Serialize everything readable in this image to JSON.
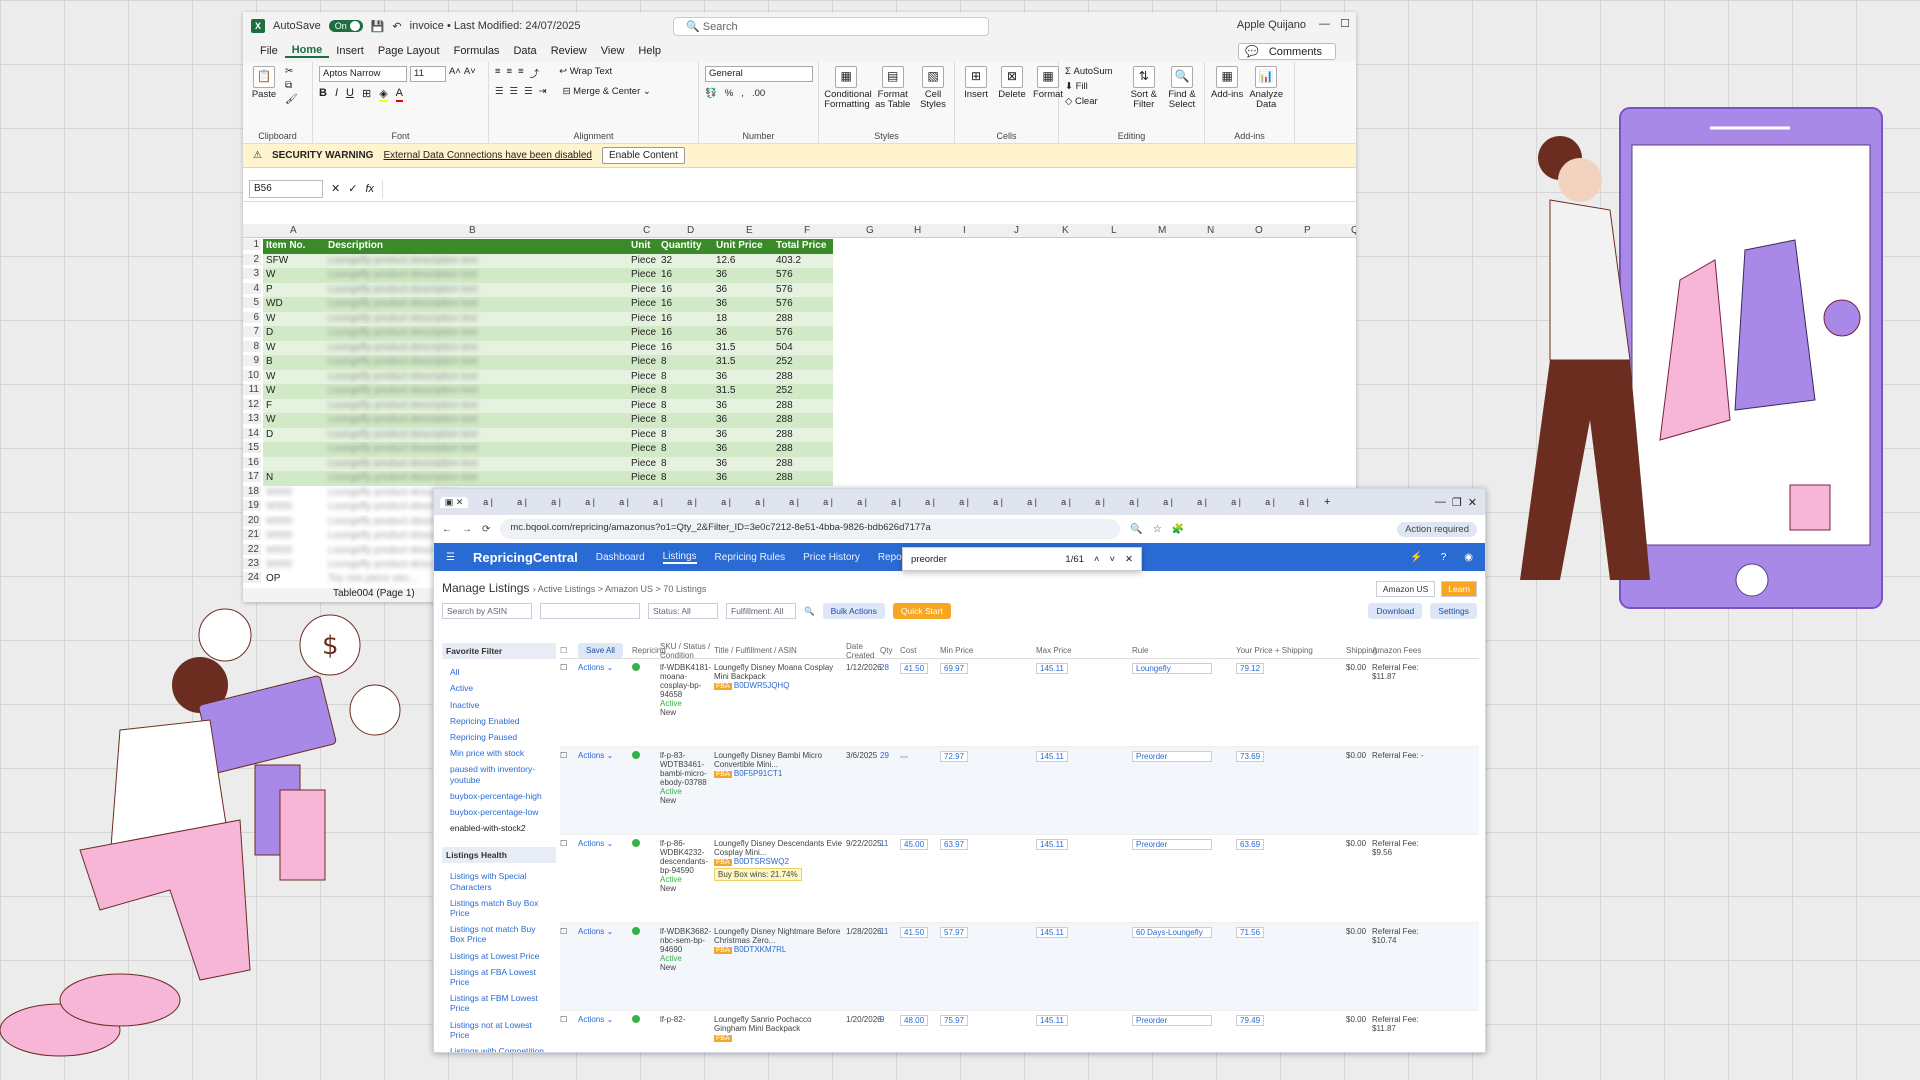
{
  "excel": {
    "autosave": "AutoSave",
    "autosave_state": "On",
    "file_title": "invoice • Last Modified: 24/07/2025",
    "search_placeholder": "Search",
    "user": "Apple Quijano",
    "menu": [
      "File",
      "Home",
      "Insert",
      "Page Layout",
      "Formulas",
      "Data",
      "Review",
      "View",
      "Help"
    ],
    "comments_btn": "Comments",
    "ribbon": {
      "paste": "Paste",
      "clipboard": "Clipboard",
      "font_name": "Aptos Narrow",
      "font_size": "11",
      "font": "Font",
      "wrap": "Wrap Text",
      "merge": "Merge & Center",
      "alignment": "Alignment",
      "number_format": "General",
      "number": "Number",
      "cond_format": "Conditional Formatting",
      "format_table": "Format as Table",
      "cell_styles": "Cell Styles",
      "styles": "Styles",
      "insert": "Insert",
      "delete": "Delete",
      "format": "Format",
      "cells": "Cells",
      "autosum": "AutoSum",
      "fill": "Fill",
      "clear": "Clear",
      "sort": "Sort & Filter",
      "find": "Find & Select",
      "editing": "Editing",
      "addins": "Add-ins",
      "analyze": "Analyze Data",
      "addins_group": "Add-ins"
    },
    "security": {
      "label": "SECURITY WARNING",
      "message": "External Data Connections have been disabled",
      "button": "Enable Content"
    },
    "name_box": "B56",
    "fx": "fx",
    "columns": [
      "A",
      "B",
      "C",
      "D",
      "E",
      "F",
      "G",
      "H",
      "I",
      "J",
      "K",
      "L",
      "M",
      "N",
      "O",
      "P",
      "Q"
    ],
    "table_headers": {
      "item": "Item No.",
      "desc": "Description",
      "unit": "Unit",
      "qty": "Quantity",
      "price": "Unit Price",
      "total": "Total Price"
    },
    "rows": [
      {
        "n": "2",
        "item": "SFW",
        "unit": "Piece",
        "qty": "32",
        "price": "12.6",
        "total": "403.2"
      },
      {
        "n": "3",
        "item": "W",
        "unit": "Piece",
        "qty": "16",
        "price": "36",
        "total": "576"
      },
      {
        "n": "4",
        "item": "P",
        "unit": "Piece",
        "qty": "16",
        "price": "36",
        "total": "576"
      },
      {
        "n": "5",
        "item": "WD",
        "unit": "Piece",
        "qty": "16",
        "price": "36",
        "total": "576"
      },
      {
        "n": "6",
        "item": "W",
        "unit": "Piece",
        "qty": "16",
        "price": "18",
        "total": "288"
      },
      {
        "n": "7",
        "item": "D",
        "unit": "Piece",
        "qty": "16",
        "price": "36",
        "total": "576"
      },
      {
        "n": "8",
        "item": "W",
        "unit": "Piece",
        "qty": "16",
        "price": "31.5",
        "total": "504"
      },
      {
        "n": "9",
        "item": "B",
        "unit": "Piece",
        "qty": "8",
        "price": "31.5",
        "total": "252"
      },
      {
        "n": "10",
        "item": "W",
        "unit": "Piece",
        "qty": "8",
        "price": "36",
        "total": "288"
      },
      {
        "n": "11",
        "item": "W",
        "unit": "Piece",
        "qty": "8",
        "price": "31.5",
        "total": "252"
      },
      {
        "n": "12",
        "item": "F",
        "unit": "Piece",
        "qty": "8",
        "price": "36",
        "total": "288"
      },
      {
        "n": "13",
        "item": "W",
        "unit": "Piece",
        "qty": "8",
        "price": "36",
        "total": "288"
      },
      {
        "n": "14",
        "item": "D",
        "unit": "Piece",
        "qty": "8",
        "price": "36",
        "total": "288"
      },
      {
        "n": "15",
        "item": "",
        "unit": "Piece",
        "qty": "8",
        "price": "36",
        "total": "288"
      },
      {
        "n": "16",
        "item": "",
        "unit": "Piece",
        "qty": "8",
        "price": "36",
        "total": "288"
      },
      {
        "n": "17",
        "item": "N",
        "unit": "Piece",
        "qty": "8",
        "price": "36",
        "total": "288"
      }
    ],
    "extra_rows": [
      "18",
      "19",
      "20",
      "21",
      "22",
      "23",
      "24"
    ],
    "last_item": "OP",
    "sheet_tab": "Table004 (Page 1)"
  },
  "browser": {
    "url": "mc.bqool.com/repricing/amazonus?o1=Qty_2&Filter_ID=3e0c7212-8e51-4bba-9826-bdb626d7177a",
    "action_required": "Action required",
    "brand": "RepricingCentral",
    "nav": [
      "Dashboard",
      "Listings",
      "Repricing Rules",
      "Price History",
      "Reports"
    ],
    "find_query": "preorder",
    "find_count": "1/61",
    "breadcrumb": "Manage Listings",
    "breadcrumb_path": "Active Listings  >  Amazon US  >  70 Listings",
    "marketplace": "Amazon US",
    "learn": "Learn",
    "toolbar": {
      "search_by": "Search by ASIN",
      "status": "Status: All",
      "fulfillment": "Fulfillment: All",
      "bulk": "Bulk Actions",
      "quick": "Quick Start",
      "download": "Download",
      "settings": "Settings",
      "save": "Save All"
    },
    "headers": [
      "Repricing",
      "SKU / Status / Condition",
      "Title / Fulfillment / ASIN",
      "Date Created",
      "Qty",
      "Cost",
      "Min Price",
      "Max Price",
      "Rule",
      "Your Price + Shipping",
      "Shipping",
      "Amazon Fees"
    ],
    "favorite_filter": "Favorite Filter",
    "filters": [
      "All",
      "Active",
      "Inactive",
      "Repricing Enabled",
      "Repricing Paused",
      "Min price with stock",
      "paused with inventory-youtube",
      "buybox-percentage-high",
      "buybox-percentage-low",
      "enabled-with-stock2"
    ],
    "listings_health": "Listings Health",
    "health": [
      "Listings with Special Characters",
      "Listings match Buy Box Price",
      "Listings not match Buy Box Price",
      "Listings at Lowest Price",
      "Listings at FBA Lowest Price",
      "Listings at FBM Lowest Price",
      "Listings not at Lowest Price",
      "Listings with Competition",
      "Listings without Competition"
    ],
    "listings": [
      {
        "sku": "lf-WDBK4181-moana-cosplay-bp-94658",
        "status": "Active",
        "cond": "New",
        "title": "Loungefly Disney Moana Cosplay Mini Backpack",
        "asin": "B0DWR5JQHQ",
        "date": "1/12/2026",
        "qty": "28",
        "cost": "41.50",
        "min": "69.97",
        "max": "145.11",
        "rule": "Loungefly",
        "price": "79.12",
        "ship": "$0.00",
        "fee": "Referral Fee: $11.87"
      },
      {
        "sku": "lf-p-83-WDTB3461-bambi-micro-ebody-03788",
        "status": "Active",
        "cond": "New",
        "title": "Loungefly Disney Bambi Micro Convertible Mini...",
        "asin": "B0F5P91CT1",
        "date": "3/6/2025",
        "qty": "29",
        "cost": "",
        "min": "72.97",
        "max": "145.11",
        "rule": "Preorder",
        "price": "73.69",
        "ship": "$0.00",
        "fee": "Referral Fee: -"
      },
      {
        "sku": "lf-p-86-WDBK4232-descendants-bp-94590",
        "status": "Active",
        "cond": "New",
        "title": "Loungefly Disney Descendants Evie Cosplay Mini...",
        "asin": "B0DTSRSWQ2",
        "date": "9/22/2025",
        "qty": "11",
        "cost": "45.00",
        "min": "63.97",
        "max": "145.11",
        "rule": "Preorder",
        "price": "63.69",
        "ship": "$0.00",
        "fee": "Referral Fee: $9.56",
        "buybox": "Buy Box wins: 21.74%"
      },
      {
        "sku": "lf-WDBK3682-nbc-sem-bp-94690",
        "status": "Active",
        "cond": "New",
        "title": "Loungefly Disney Nightmare Before Christmas Zero...",
        "asin": "B0DTXKM7RL",
        "date": "1/28/2026",
        "qty": "11",
        "cost": "41.50",
        "min": "57.97",
        "max": "145.11",
        "rule": "60 Days-Loungefly",
        "price": "71.56",
        "ship": "$0.00",
        "fee": "Referral Fee: $10.74"
      },
      {
        "sku": "lf-p-82-",
        "status": "",
        "cond": "",
        "title": "Loungefly Sanrio Pochacco Gingham Mini Backpack",
        "asin": "",
        "date": "1/20/2026",
        "qty": "9",
        "cost": "48.00",
        "min": "75.97",
        "max": "145.11",
        "rule": "Preorder",
        "price": "79.49",
        "ship": "$0.00",
        "fee": "Referral Fee: $11.87"
      }
    ]
  },
  "colors": {
    "excel_green": "#1d6f42",
    "table_green": "#3a8a2a",
    "rc_blue": "#2a6ad3",
    "highlight": "#ffe600",
    "purple": "#a989e8",
    "pink": "#f7b6d7"
  }
}
